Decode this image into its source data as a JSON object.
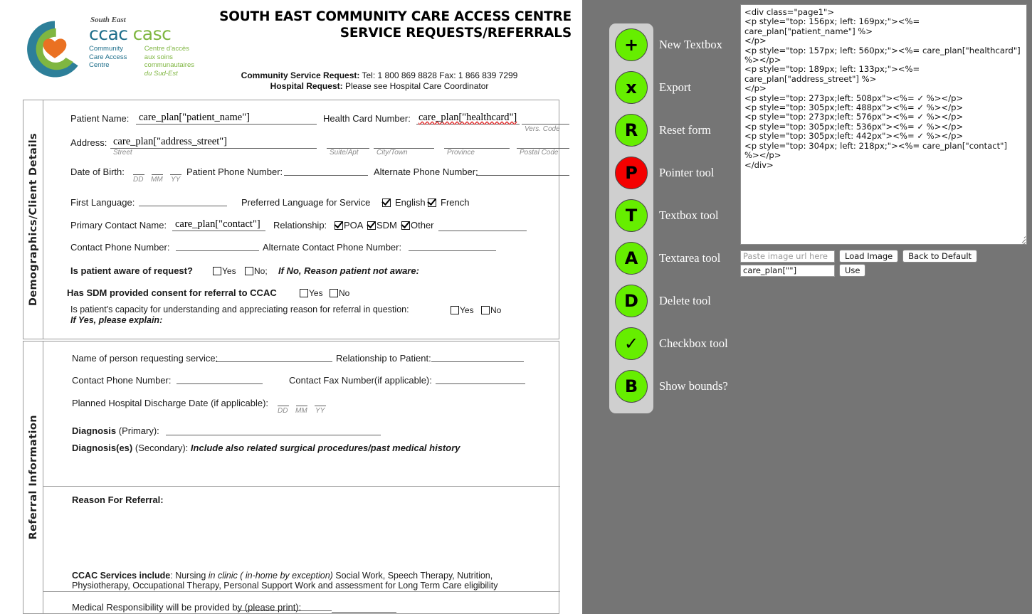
{
  "document": {
    "logo": {
      "south_east": "South East",
      "ccac": "ccac",
      "casc": "casc",
      "sub_en_line1": "Community",
      "sub_en_line2": "Care Access",
      "sub_en_line3": "Centre",
      "sub_fr_line1": "Centre d'accès",
      "sub_fr_line2": "aux soins",
      "sub_fr_line3": "communautaires",
      "sub_fr_line4": "du Sud-Est"
    },
    "title_line1": "SOUTH EAST COMMUNITY CARE ACCESS CENTRE",
    "title_line2": "SERVICE REQUESTS/REFERRALS",
    "contact_community_label": "Community Service Request:",
    "contact_community_value": "Tel: 1 800 869 8828  Fax: 1 866 839 7299",
    "contact_hospital_label": "Hospital  Request:",
    "contact_hospital_value": "Please see Hospital Care Coordinator",
    "sections": {
      "demographics": {
        "side_label": "Demographics/Client Details",
        "patient_name_label": "Patient  Name:",
        "patient_name_value": "care_plan[\"patient_name\"]",
        "health_card_label": "Health Card Number:",
        "health_card_value": "care_plan[\"healthcard\"]",
        "vers_code_hint": "Vers.  Code",
        "address_label": "Address:",
        "address_value": "care_plan[\"address_street\"]",
        "street_hint": "Street",
        "suite_hint": "Suite/Apt",
        "city_hint": "City/Town",
        "province_hint": "Province",
        "postal_hint": "Postal Code",
        "dob_label": "Date of Birth:",
        "dd_hint": "DD",
        "mm_hint": "MM",
        "yy_hint": "YY",
        "patient_phone_label": "Patient Phone Number:",
        "alt_phone_label": "Alternate Phone Number:",
        "first_language_label": "First Language:",
        "preferred_language_label": "Preferred Language for Service",
        "english_label": "English",
        "english_checked": true,
        "french_label": "French",
        "french_checked": true,
        "primary_contact_label": "Primary Contact Name:",
        "primary_contact_value": "care_plan[\"contact\"]",
        "relationship_label": "Relationship:",
        "poa_label": "POA",
        "poa_checked": true,
        "sdm_label": "SDM",
        "sdm_checked": true,
        "other_label": "Other",
        "other_checked": true,
        "contact_phone_label": "Contact Phone Number:",
        "alt_contact_phone_label": "Alternate Contact Phone Number:",
        "aware_label": "Is patient aware of request?",
        "aware_yes": "Yes",
        "aware_no": "No;",
        "aware_ifno": "If No, Reason patient not aware:",
        "sdm_consent_label": "Has SDM provided consent for referral to CCAC",
        "sdm_yes": "Yes",
        "sdm_no": "No",
        "capacity_label": "Is patient's capacity for understanding and appreciating reason for referral in question:",
        "capacity_yes": "Yes",
        "capacity_no": "No",
        "capacity_ifyes": "If Yes, please explain:"
      },
      "referral": {
        "side_label": "Referral Information",
        "requester_name_label": "Name of person requesting service:",
        "relationship_to_patient_label": "Relationship to Patient:",
        "contact_phone_label": "Contact Phone Number:",
        "contact_fax_label": "Contact Fax Number(if applicable):",
        "discharge_label": "Planned Hospital Discharge Date (if applicable):",
        "dd_hint": "DD",
        "mm_hint": "MM",
        "yy_hint": "YY",
        "diagnosis_primary_bold": "Diagnosis",
        "diagnosis_primary_rest": " (Primary):",
        "diagnosis_secondary_bold": "Diagnosis(es)",
        "diagnosis_secondary_rest": " (Secondary):",
        "diagnosis_secondary_italic": "Include also related surgical procedures/past medical history",
        "reason_label": "Reason For Referral:",
        "services_bold": "CCAC Services include",
        "services_rest1": ": Nursing ",
        "services_italic": "in clinic ( in-home by exception)",
        "services_rest2": " Social Work, Speech Therapy, Nutrition,",
        "services_line2": "Physiotherapy, Occupational Therapy,  Personal Support Work and assessment for  Long Term Care eligibility",
        "medical_resp_label": "Medical Responsibility will be provided by (please print):"
      }
    }
  },
  "toolbar": {
    "items": [
      {
        "glyph": "+",
        "label": "New Textbox",
        "color": "green",
        "icon": "plus-icon"
      },
      {
        "glyph": "x",
        "label": "Export",
        "color": "green",
        "icon": "export-x-icon"
      },
      {
        "glyph": "R",
        "label": "Reset form",
        "color": "green",
        "icon": "reset-r-icon"
      },
      {
        "glyph": "P",
        "label": "Pointer tool",
        "color": "red",
        "icon": "pointer-p-icon"
      },
      {
        "glyph": "T",
        "label": "Textbox tool",
        "color": "green",
        "icon": "textbox-t-icon"
      },
      {
        "glyph": "A",
        "label": "Textarea tool",
        "color": "green",
        "icon": "textarea-a-icon"
      },
      {
        "glyph": "D",
        "label": "Delete tool",
        "color": "green",
        "icon": "delete-d-icon"
      },
      {
        "glyph": "✓",
        "label": "Checkbox tool",
        "color": "green",
        "icon": "checkmark-icon"
      },
      {
        "glyph": "B",
        "label": "Show bounds?",
        "color": "green",
        "icon": "bounds-b-icon"
      }
    ],
    "colors": {
      "green": "#66ee00",
      "red": "#f40000",
      "panel": "#cfcfcf",
      "background": "#757575"
    }
  },
  "code_panel": {
    "code": "<div class=\"page1\">\n<p style=\"top: 156px; left: 169px;\"><%= care_plan[\"patient_name\"] %>\n</p>\n<p style=\"top: 157px; left: 560px;\"><%= care_plan[\"healthcard\"] %></p>\n<p style=\"top: 189px; left: 133px;\"><%= care_plan[\"address_street\"] %>\n</p>\n<p style=\"top: 273px;left: 508px\"><%= ✓ %></p>\n<p style=\"top: 305px;left: 488px\"><%= ✓ %></p>\n<p style=\"top: 273px;left: 576px\"><%= ✓ %></p>\n<p style=\"top: 305px;left: 536px\"><%= ✓ %></p>\n<p style=\"top: 305px;left: 442px\"><%= ✓ %></p>\n<p style=\"top: 304px; left: 218px;\"><%= care_plan[\"contact\"] %></p>\n</div>",
    "image_url_placeholder": "Paste image url here",
    "image_url_value": "",
    "load_image_label": "Load Image",
    "back_to_default_label": "Back to Default",
    "binding_value": "care_plan[\"\"]",
    "use_label": "Use"
  }
}
